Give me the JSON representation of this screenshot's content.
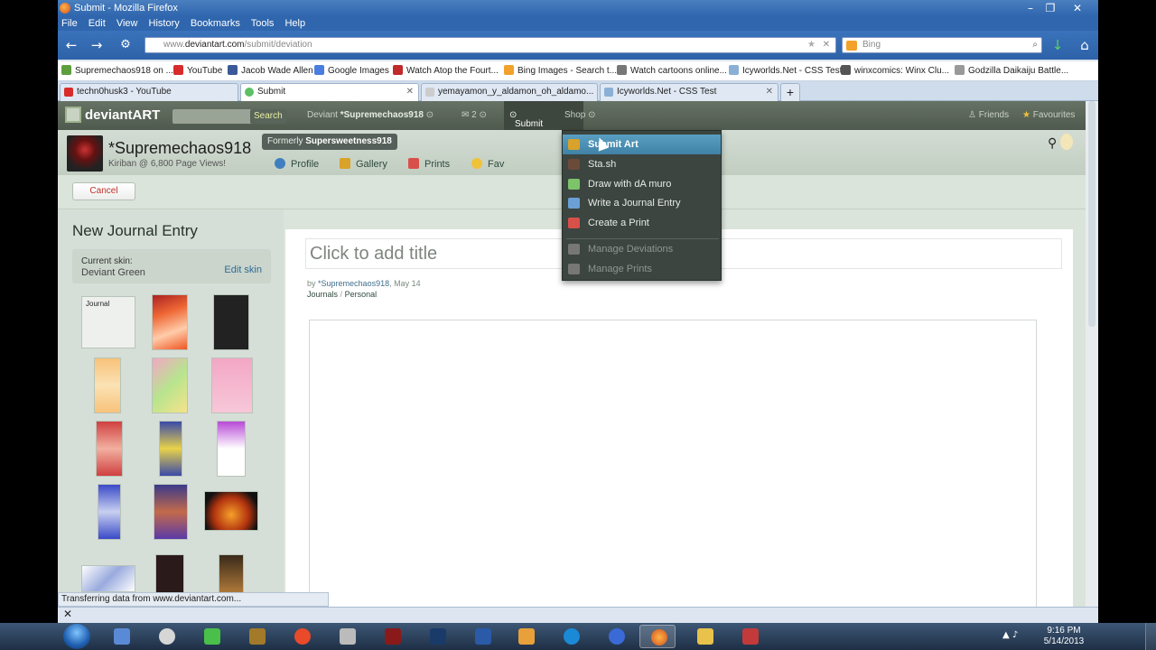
{
  "window": {
    "title": "Submit - Mozilla Firefox",
    "menu": [
      "File",
      "Edit",
      "View",
      "History",
      "Bookmarks",
      "Tools",
      "Help"
    ]
  },
  "nav": {
    "url_prefix": "www.",
    "url_domain": "deviantart.com",
    "url_path": "/submit/deviation",
    "search_placeholder": "Bing"
  },
  "bookmarks": [
    {
      "label": "Supremechaos918 on ...",
      "color": "#5f9e3f"
    },
    {
      "label": "YouTube",
      "color": "#d82b2b"
    },
    {
      "label": "Jacob Wade Allen",
      "color": "#3b5998"
    },
    {
      "label": "Google Images",
      "color": "#4a7de0"
    },
    {
      "label": "Watch Atop the Fourt...",
      "color": "#c12a2a"
    },
    {
      "label": "Bing Images - Search t...",
      "color": "#f2a12b"
    },
    {
      "label": "Watch cartoons online...",
      "color": "#777"
    },
    {
      "label": "Icyworlds.Net - CSS Test",
      "color": "#8ab0d6"
    },
    {
      "label": "winxcomics: Winx Clu...",
      "color": "#555"
    },
    {
      "label": "Godzilla Daikaiju Battle...",
      "color": "#999"
    }
  ],
  "tabs": [
    {
      "label": "techn0husk3 - YouTube",
      "color": "#d82b2b"
    },
    {
      "label": "Submit",
      "color": "#5cc065"
    },
    {
      "label": "yemayamon_y_aldamon_oh_aldamo...",
      "color": "#ccc"
    },
    {
      "label": "Icyworlds.Net - CSS Test",
      "color": "#8ab0d6"
    }
  ],
  "da_header": {
    "logo": "deviantART",
    "search_button": "Search",
    "deviant_prefix": "Deviant",
    "username": "*Supremechaos918",
    "messages_count": "2",
    "submit": "Submit",
    "shop": "Shop",
    "friends": "Friends",
    "favourites": "Favourites"
  },
  "profile": {
    "name": "*Supremechaos918",
    "tagline": "Kiriban @ 6,800 Page Views!",
    "formerly_prefix": "Formerly",
    "formerly_name": "Supersweetness918",
    "links": [
      "Profile",
      "Gallery",
      "Prints",
      "Fav"
    ]
  },
  "actions": {
    "cancel": "Cancel"
  },
  "sidebar": {
    "heading": "New Journal Entry",
    "current_skin_label": "Current skin:",
    "current_skin_value": "Deviant Green",
    "edit_skin": "Edit skin",
    "first_skin_label": "Journal"
  },
  "editor": {
    "title_placeholder": "Click to add title",
    "by": "by",
    "author": "*Supremechaos918",
    "date": ", May 14",
    "crumb_1": "Journals",
    "crumb_sep": "/",
    "crumb_2": "Personal"
  },
  "submit_menu": [
    {
      "label": "Submit Art",
      "state": "highlighted",
      "color": "#d9a22a"
    },
    {
      "label": "Sta.sh",
      "state": "normal",
      "color": "#6b4a3a"
    },
    {
      "label": "Draw with dA muro",
      "state": "normal",
      "color": "#7cc36a"
    },
    {
      "label": "Write a Journal Entry",
      "state": "normal",
      "color": "#6aa0d6"
    },
    {
      "label": "Create a Print",
      "state": "normal",
      "color": "#d8504a"
    },
    {
      "label": "Manage Deviations",
      "state": "disabled",
      "color": "#777"
    },
    {
      "label": "Manage Prints",
      "state": "disabled",
      "color": "#777"
    }
  ],
  "status": "Transferring data from www.deviantart.com...",
  "clock": {
    "time": "9:16 PM",
    "date": "5/14/2013"
  }
}
